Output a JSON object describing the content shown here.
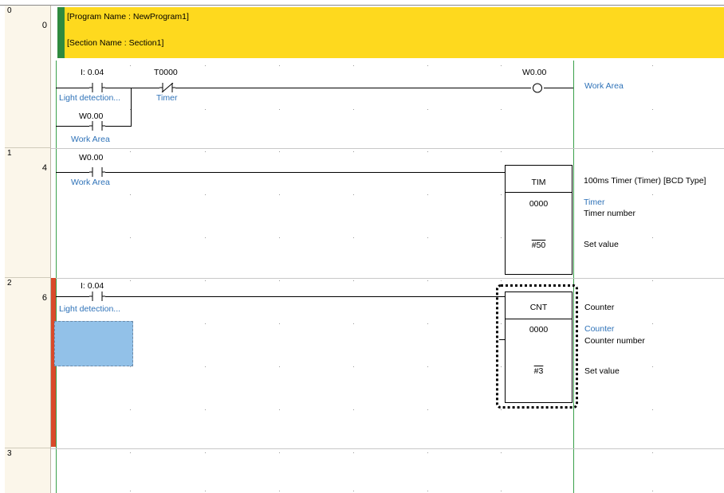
{
  "rung_numbers": [
    "0",
    "1",
    "2",
    "3"
  ],
  "step_numbers": [
    "0",
    "4",
    "6"
  ],
  "comment": {
    "program_name": "[Program Name : NewProgram1]",
    "section_name": "[Section Name : Section1]"
  },
  "rung0": {
    "contact1_addr": "I: 0.04",
    "contact1_comment": "Light detection...",
    "contact2_addr": "T0000",
    "contact2_comment": "Timer",
    "contact3_addr": "W0.00",
    "contact3_comment": "Work Area",
    "coil_addr": "W0.00",
    "coil_comment": "Work Area"
  },
  "rung1": {
    "contact_addr": "W0.00",
    "contact_comment": "Work Area",
    "box_name": "TIM",
    "box_desc": "100ms Timer (Timer) [BCD Type]",
    "operand1": "0000",
    "operand1_comment": "Timer",
    "operand1_desc": "Timer number",
    "operand2": "#50",
    "operand2_desc": "Set value"
  },
  "rung2": {
    "contact_addr": "I: 0.04",
    "contact_comment": "Light detection...",
    "box_name": "CNT",
    "box_desc": "Counter",
    "operand1": "0000",
    "operand1_comment": "Counter",
    "operand1_desc": "Counter number",
    "operand2": "#3",
    "operand2_desc": "Set value"
  },
  "colors": {
    "comment_bg": "#fed91e",
    "comment_marker": "#2f8a3f",
    "rung_marker": "#d94a2a",
    "power_rail": "#3aa04a",
    "comment_text": "#2e72b8",
    "selection": "#92c1e8"
  }
}
